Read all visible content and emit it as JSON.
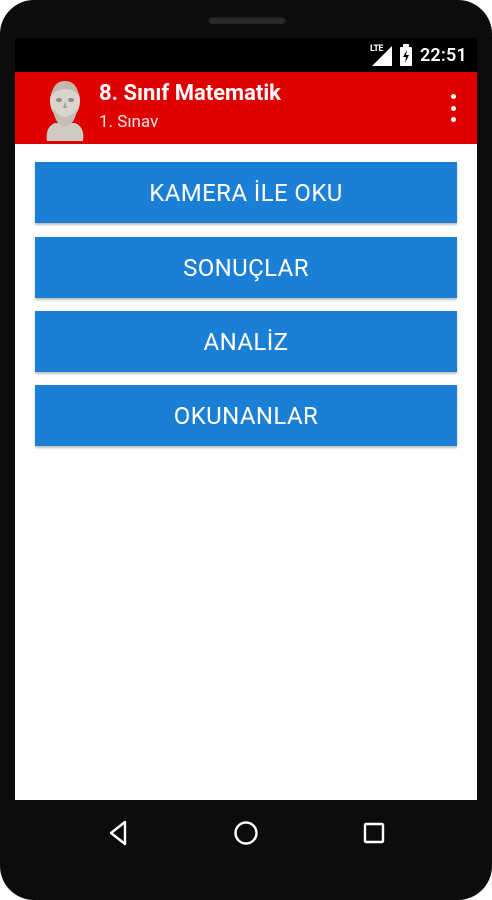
{
  "status_bar": {
    "network": "LTE",
    "time": "22:51"
  },
  "app_bar": {
    "title": "8. Sınıf Matematik",
    "subtitle": "1. Sınav",
    "avatar_icon": "plato-bust-icon",
    "menu_icon": "more-vert-icon",
    "color": "#df0000"
  },
  "menu_buttons": [
    {
      "label": "KAMERA İLE OKU"
    },
    {
      "label": "SONUÇLAR"
    },
    {
      "label": "ANALİZ"
    },
    {
      "label": "OKUNANLAR"
    }
  ],
  "button_color": "#1b7fd6",
  "nav_bar": {
    "back_icon": "back-triangle-icon",
    "home_icon": "home-circle-icon",
    "recent_icon": "recent-apps-icon"
  }
}
